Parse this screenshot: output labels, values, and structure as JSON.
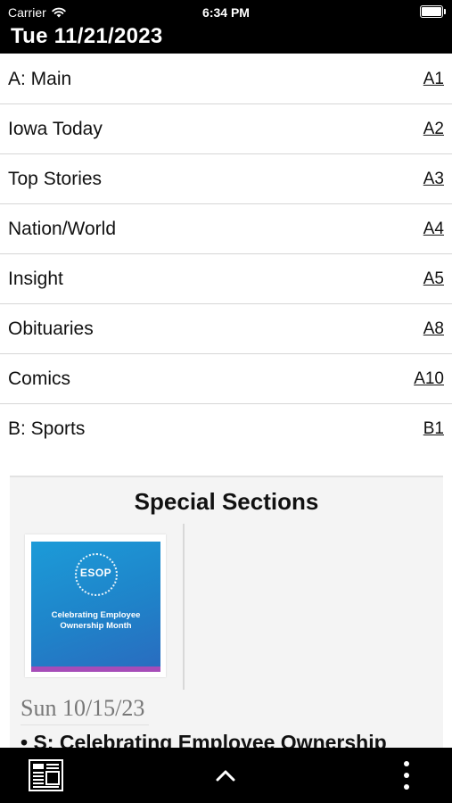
{
  "status_bar": {
    "carrier": "Carrier",
    "time": "6:34 PM",
    "icons": [
      "wifi-icon",
      "battery-icon"
    ]
  },
  "header": {
    "date": "Tue 11/21/2023"
  },
  "sections": [
    {
      "name": "A: Main",
      "page": "A1"
    },
    {
      "name": "Iowa Today",
      "page": "A2"
    },
    {
      "name": "Top Stories",
      "page": "A3"
    },
    {
      "name": "Nation/World",
      "page": "A4"
    },
    {
      "name": "Insight",
      "page": "A5"
    },
    {
      "name": "Obituaries",
      "page": "A8"
    },
    {
      "name": "Comics",
      "page": "A10"
    },
    {
      "name": "B: Sports",
      "page": "B1"
    }
  ],
  "special_sections": {
    "title": "Special Sections",
    "thumbnail": {
      "logo_text": "ESOP",
      "line1": "Celebrating Employee",
      "line2": "Ownership Month"
    },
    "date": "Sun 10/15/23",
    "item": "• S: Celebrating Employee Ownership"
  },
  "bottom_bar": {
    "icons": [
      "newspaper-icon",
      "chevron-up-icon",
      "more-vertical-icon"
    ]
  },
  "colors": {
    "bar_background": "#000000",
    "special_background": "#f4f4f4",
    "thumbnail_blue": "#1f83c9",
    "thumbnail_accent": "#a64cb8"
  }
}
